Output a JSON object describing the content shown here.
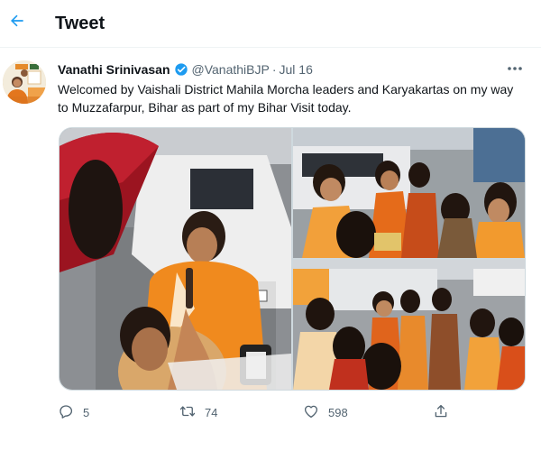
{
  "header": {
    "title": "Tweet",
    "back_icon": "arrow-left-icon",
    "accent_color": "#1d9bf0"
  },
  "tweet": {
    "author_name": "Vanathi Srinivasan",
    "verified": true,
    "handle": "@VanathiBJP",
    "separator": "·",
    "date": "Jul 16",
    "text": "Welcomed by Vaishali District Mahila Morcha leaders and Karyakartas on my way to Muzzafarpur, Bihar as part of my Bihar Visit today.",
    "media_count": 3,
    "stats": {
      "replies": "5",
      "retweets": "74",
      "likes": "598"
    }
  },
  "icons": {
    "more": "more-options-icon",
    "reply": "reply-icon",
    "retweet": "retweet-icon",
    "like": "heart-icon",
    "share": "share-icon",
    "verified": "verified-badge-icon"
  },
  "colors": {
    "text_primary": "#0f1419",
    "text_secondary": "#536471",
    "border": "#cfd9de",
    "verified_blue": "#1d9bf0"
  }
}
